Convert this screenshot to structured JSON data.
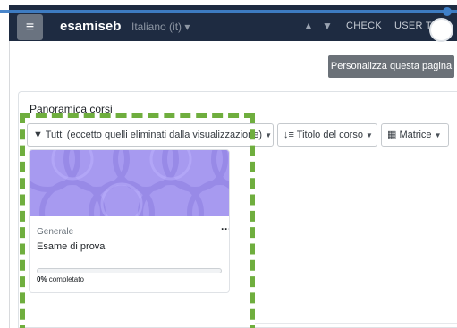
{
  "navbar": {
    "brand": "esamiseb",
    "language": "Italiano (it) ▾",
    "check_label": "CHECK",
    "user_label": "USER T",
    "toggle_icon": "hamburger-icon"
  },
  "page": {
    "customize_button": "Personalizza questa pagina"
  },
  "block": {
    "title": "Panoramica corsi",
    "filters": {
      "grouping": "Tutti (eccetto quelli eliminati dalla visualizzazione)",
      "sort": "Titolo del corso",
      "view": "Matrice"
    }
  },
  "course": {
    "category": "Generale",
    "name": "Esame di prova",
    "more_label": "···",
    "progress_percent": 0,
    "progress_value": "0%",
    "progress_suffix": " completato"
  },
  "colors": {
    "navbar_bg": "#1e2b41",
    "highlight": "#6fae3e",
    "card_image": "#a79af0",
    "overlay_line": "#3f80c8"
  }
}
